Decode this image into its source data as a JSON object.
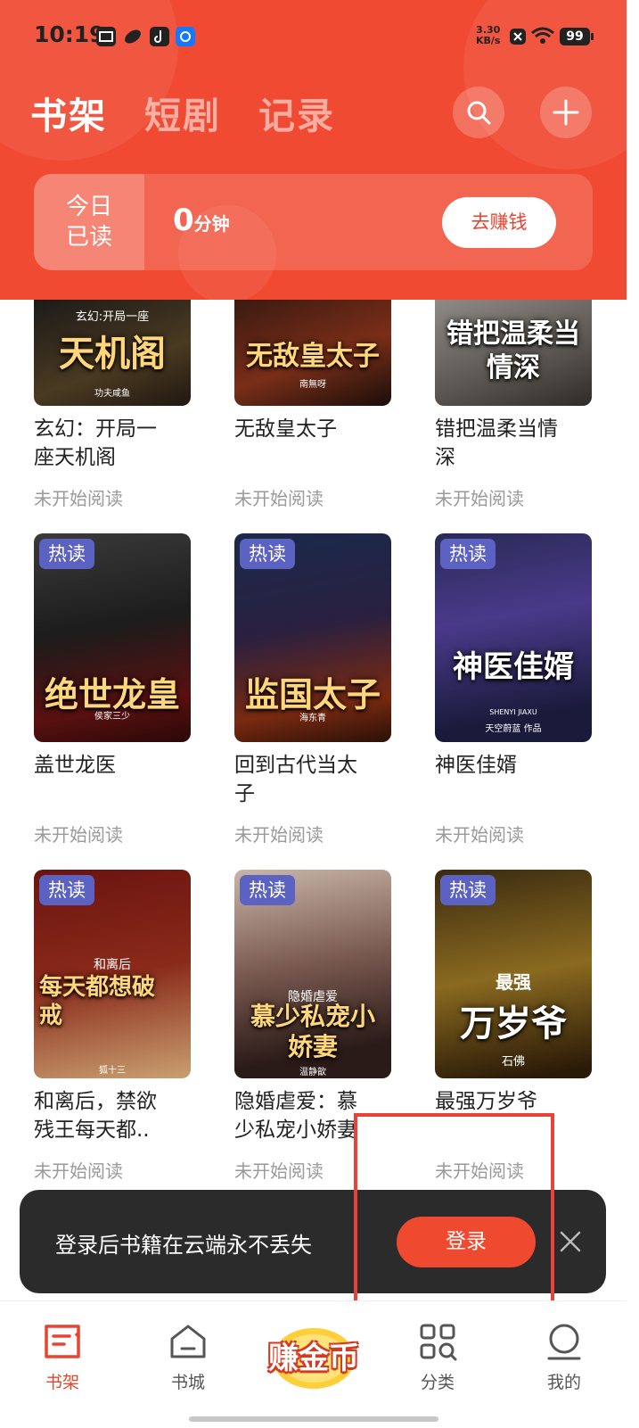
{
  "status_bar": {
    "time": "10:19",
    "net_speed": "3.30",
    "net_unit": "KB/s",
    "battery": "99"
  },
  "header": {
    "tabs": [
      {
        "label": "书架",
        "active": true
      },
      {
        "label": "短剧",
        "active": false
      },
      {
        "label": "记录",
        "active": false
      }
    ],
    "search_icon": "search-icon",
    "add_icon": "plus-icon"
  },
  "reading_card": {
    "label_line1": "今日",
    "label_line2": "已读",
    "value": "0",
    "unit": "分钟",
    "button": "去赚钱"
  },
  "books": [
    {
      "title_line1": "玄幻：开局一",
      "title_line2": "座天机阁",
      "status": "未开始阅读",
      "cover_text": "天机阁",
      "cover_sub": "玄幻:开局一座",
      "author": "功夫咸鱼",
      "hot": false
    },
    {
      "title_line1": "无敌皇太子",
      "title_line2": "",
      "status": "未开始阅读",
      "cover_text": "无敌皇太子",
      "cover_sub": "",
      "author": "南無呀",
      "hot": false
    },
    {
      "title_line1": "错把温柔当情",
      "title_line2": "深",
      "status": "未开始阅读",
      "cover_text": "错把温柔当情深",
      "cover_sub": "",
      "author": "",
      "hot": false
    },
    {
      "title_line1": "盖世龙医",
      "title_line2": "",
      "status": "未开始阅读",
      "cover_text": "绝世龙皇",
      "cover_sub": "",
      "author": "侯家三少",
      "hot": true
    },
    {
      "title_line1": "回到古代当太",
      "title_line2": "子",
      "status": "未开始阅读",
      "cover_text": "监国太子",
      "cover_sub": "",
      "author": "海东青",
      "hot": true
    },
    {
      "title_line1": "神医佳婿",
      "title_line2": "",
      "status": "未开始阅读",
      "cover_text": "神医佳婿",
      "cover_sub": "SHENYI JIAXU",
      "author": "天空蔚蓝 作品",
      "hot": true
    },
    {
      "title_line1": "和离后，禁欲",
      "title_line2": "残王每天都..",
      "status": "未开始阅读",
      "cover_text": "每天都想破戒",
      "cover_sub": "和离后",
      "author": "狐十三",
      "hot": true
    },
    {
      "title_line1": "隐婚虐爱：慕",
      "title_line2": "少私宠小娇妻",
      "status": "未开始阅读",
      "cover_text": "慕少私宠小娇妻",
      "cover_sub": "隐婚虐爱",
      "author": "温静歆",
      "hot": true
    },
    {
      "title_line1": "最强万岁爷",
      "title_line2": "",
      "status": "未开始阅读",
      "cover_text": "万岁爷",
      "cover_sub": "最强",
      "author": "石佛",
      "hot": true
    }
  ],
  "hot_label": "热读",
  "banner": {
    "text": "登录后书籍在云端永不丢失",
    "login_button": "登录"
  },
  "bottom_nav": [
    {
      "label": "书架",
      "icon": "bookshelf-icon",
      "active": true
    },
    {
      "label": "书城",
      "icon": "home-icon",
      "active": false
    },
    {
      "label": "赚金币",
      "icon": "earn-coins-badge",
      "active": false
    },
    {
      "label": "分类",
      "icon": "category-grid-icon",
      "active": false
    },
    {
      "label": "我的",
      "icon": "profile-icon",
      "active": false
    }
  ],
  "colors": {
    "header": "#f04a32",
    "accent": "#e8452f",
    "hot_badge": "#5b62c2",
    "banner": "#2b2b2b",
    "highlight_box": "#e9423a"
  }
}
